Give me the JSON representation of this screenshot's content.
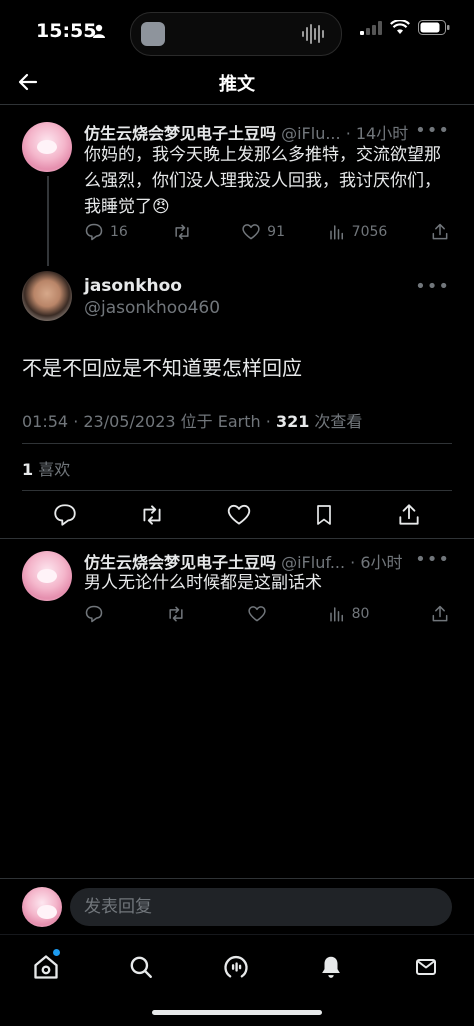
{
  "status": {
    "time": "15:55"
  },
  "header": {
    "title": "推文"
  },
  "parent_tweet": {
    "name": "仿生云烧会梦见电子土豆吗",
    "handle": "@iFlu...",
    "time": "· 14小时",
    "text": "你妈的，我今天晚上发那么多推特，交流欲望那么强烈，你们没人理我没人回我，我讨厌你们，我睡觉了😠",
    "replies": "16",
    "retweets": "",
    "likes": "91",
    "views": "7056"
  },
  "main_tweet": {
    "name": "jasonkhoo",
    "handle": "@jasonkhoo460",
    "text": "不是不回应是不知道要怎样回应",
    "meta_prefix": "01:54 · 23/05/2023 位于 Earth · ",
    "views_count": "321",
    "views_label": " 次查看",
    "likes_count": "1",
    "likes_label": " 喜欢"
  },
  "reply_tweet": {
    "name": "仿生云烧会梦见电子土豆吗",
    "handle": "@iFluf...",
    "time": "· 6小时",
    "text": "男人无论什么时候都是这副话术",
    "views": "80"
  },
  "reply_bar": {
    "placeholder": "发表回复"
  },
  "colors": {
    "accent": "#1d9bf0",
    "muted": "#71767b",
    "text": "#e7e9ea",
    "background": "#000000"
  }
}
